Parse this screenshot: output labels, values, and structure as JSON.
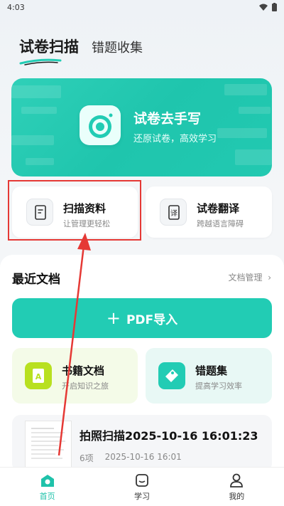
{
  "status_bar": {
    "time": "4:03"
  },
  "tabs": {
    "active": "试卷扫描",
    "inactive": "错题收集"
  },
  "hero": {
    "title": "试卷去手写",
    "subtitle": "还原试卷，高效学习"
  },
  "features": [
    {
      "title": "扫描资料",
      "subtitle": "让管理更轻松"
    },
    {
      "title": "试卷翻译",
      "subtitle": "跨越语言障碍"
    }
  ],
  "docs": {
    "title": "最近文档",
    "manage": "文档管理"
  },
  "pdf_import": {
    "plus": "+",
    "label": "PDF导入"
  },
  "sub_cards": [
    {
      "title": "书籍文档",
      "subtitle": "开启知识之旅",
      "bg": "#f4fbe8",
      "icon_color": "#b8e020"
    },
    {
      "title": "错题集",
      "subtitle": "提高学习效率",
      "bg": "#e8f8f5",
      "icon_color": "#22ccb4"
    }
  ],
  "scan_item": {
    "title": "拍照扫描2025-10-16 16:01:23",
    "count": "6项",
    "date": "2025-10-16 16:01"
  },
  "nav": [
    {
      "label": "首页",
      "icon": "home-icon"
    },
    {
      "label": "学习",
      "icon": "study-icon"
    },
    {
      "label": "我的",
      "icon": "user-icon"
    }
  ],
  "colors": {
    "accent": "#22ccb4",
    "highlight": "#e53935"
  }
}
